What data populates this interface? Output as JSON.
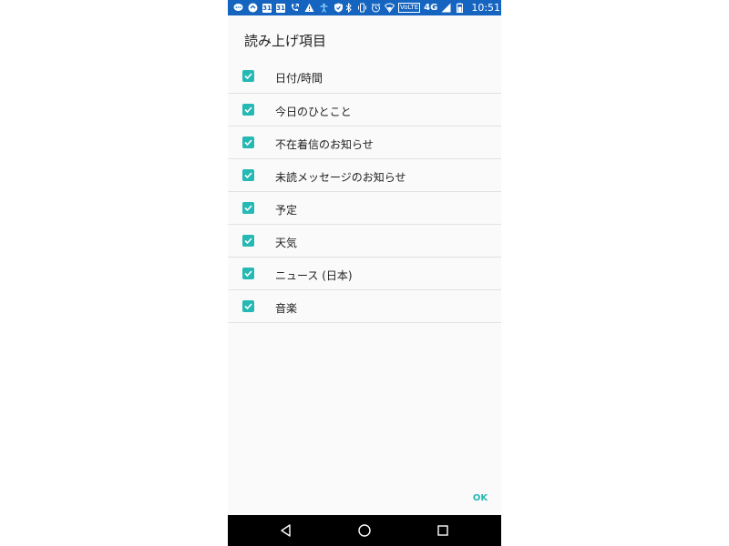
{
  "status_bar": {
    "calendar_day_1": "31",
    "calendar_day_2": "31",
    "volte": "VoLTE",
    "network": "4G",
    "time": "10:51",
    "icons": [
      "message-icon",
      "sync-icon",
      "calendar-icon",
      "calendar-icon",
      "call-forward-icon",
      "warning-icon",
      "accessibility-icon",
      "shield-icon",
      "bluetooth-icon",
      "vibrate-icon",
      "alarm-icon",
      "wifi-icon",
      "signal-icon",
      "battery-icon"
    ]
  },
  "dialog": {
    "title": "読み上げ項目",
    "items": [
      {
        "label": "日付/時間",
        "checked": true
      },
      {
        "label": "今日のひとこと",
        "checked": true
      },
      {
        "label": "不在着信のお知らせ",
        "checked": true
      },
      {
        "label": "未読メッセージのお知らせ",
        "checked": true
      },
      {
        "label": "予定",
        "checked": true
      },
      {
        "label": "天気",
        "checked": true
      },
      {
        "label": "ニュース (日本)",
        "checked": true
      },
      {
        "label": "音楽",
        "checked": true
      }
    ],
    "ok_label": "OK"
  },
  "colors": {
    "status_bar": "#1565c0",
    "accent": "#26b8b3",
    "background": "#fafafa",
    "nav_bar": "#000000"
  }
}
